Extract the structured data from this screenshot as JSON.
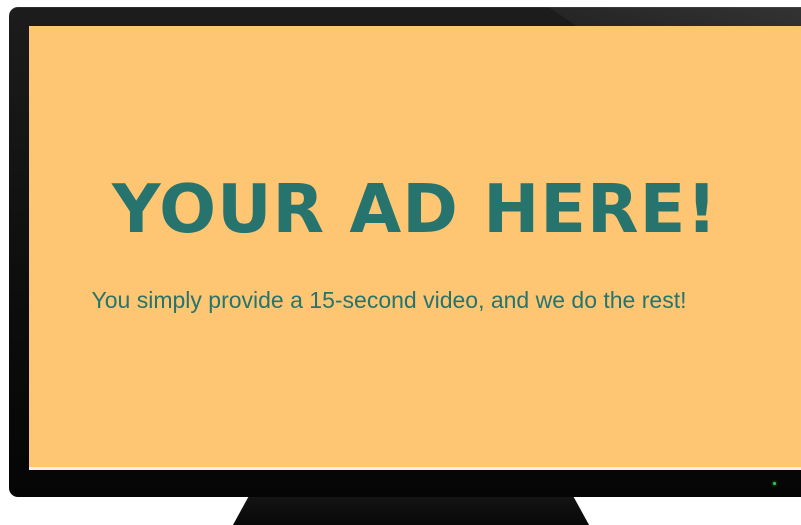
{
  "ad": {
    "headline": "YOUR AD HERE!",
    "subtext": "You simply provide a 15-second video, and we do the rest!"
  },
  "colors": {
    "screen_background": "#fec673",
    "text": "#26746d",
    "bezel": "#111111",
    "power_led": "#3cc84a"
  },
  "icons": {
    "power_indicator": "power-led-icon"
  }
}
